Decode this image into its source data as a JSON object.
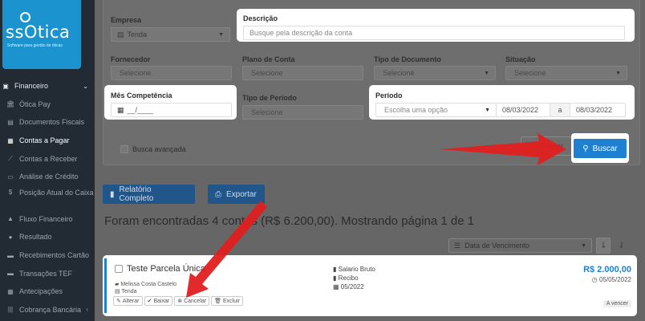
{
  "brand": {
    "name": "ssOtica",
    "tagline": "Software para gestão de óticas"
  },
  "sidebar": {
    "section": "Financeiro",
    "items": [
      {
        "label": "Ótica Pay",
        "icon": "bank-icon"
      },
      {
        "label": "Documentos Fiscais",
        "icon": "document-icon"
      },
      {
        "label": "Contas a Pagar",
        "icon": "calculator-icon"
      },
      {
        "label": "Contas a Receber",
        "icon": "line-chart-icon"
      },
      {
        "label": "Análise de Crédito",
        "icon": "id-card-icon"
      },
      {
        "label": "Posição Atual do Caixa",
        "icon": "dollar-icon"
      },
      {
        "label": "Fluxo Financeiro",
        "icon": "area-chart-icon"
      },
      {
        "label": "Resultado",
        "icon": "pie-chart-icon"
      },
      {
        "label": "Recebimentos Cartão",
        "icon": "credit-card-icon"
      },
      {
        "label": "Transações TEF",
        "icon": "credit-card-icon"
      },
      {
        "label": "Antecipações",
        "icon": "calendar-icon"
      },
      {
        "label": "Cobrança Bancária",
        "icon": "barcode-icon"
      }
    ]
  },
  "filters": {
    "empresa": {
      "label": "Empresa",
      "value": "Tenda"
    },
    "descricao": {
      "label": "Descrição",
      "placeholder": "Busque pela descrição da conta"
    },
    "fornecedor": {
      "label": "Fornecedor",
      "value": "Selecione"
    },
    "plano_conta": {
      "label": "Plano de Conta",
      "value": "Selecione"
    },
    "tipo_documento": {
      "label": "Tipo de Documento",
      "value": "Selecione"
    },
    "situacao": {
      "label": "Situação",
      "value": "Selecione"
    },
    "mes_competencia": {
      "label": "Mês Competência",
      "value": "__/____"
    },
    "tipo_periodo": {
      "label": "Tipo de Período",
      "value": "Selecione"
    },
    "periodo": {
      "label": "Período",
      "option": "Escolha uma opção",
      "start": "08/03/2022",
      "sep": "a",
      "end": "08/03/2022"
    },
    "busca_avancada": "Busca avançada",
    "clear_label": "Limpar",
    "search_label": "Buscar"
  },
  "actions": {
    "report": "Relatório Completo",
    "export": "Exportar"
  },
  "results": {
    "summary": "Foram encontradas 4 contas (R$ 6.200,00). Mostrando página 1 de 1",
    "sort_by": "Data de Vencimento"
  },
  "card": {
    "title": "Teste Parcela Única",
    "person": "Melissa Costa Castelo",
    "company": "Tenda",
    "category": "Salario Bruto",
    "doc_type": "Recibo",
    "competence": "05/2022",
    "amount": "R$ 2.000,00",
    "due_date": "05/05/2022",
    "status": "A vencer",
    "buttons": {
      "edit": "Alterar",
      "settle": "Baixar",
      "cancel": "Cancelar",
      "delete": "Excluir"
    }
  },
  "colors": {
    "primary": "#1f7fd0",
    "arrow": "#e01f1f",
    "sidebar": "#222a33"
  }
}
